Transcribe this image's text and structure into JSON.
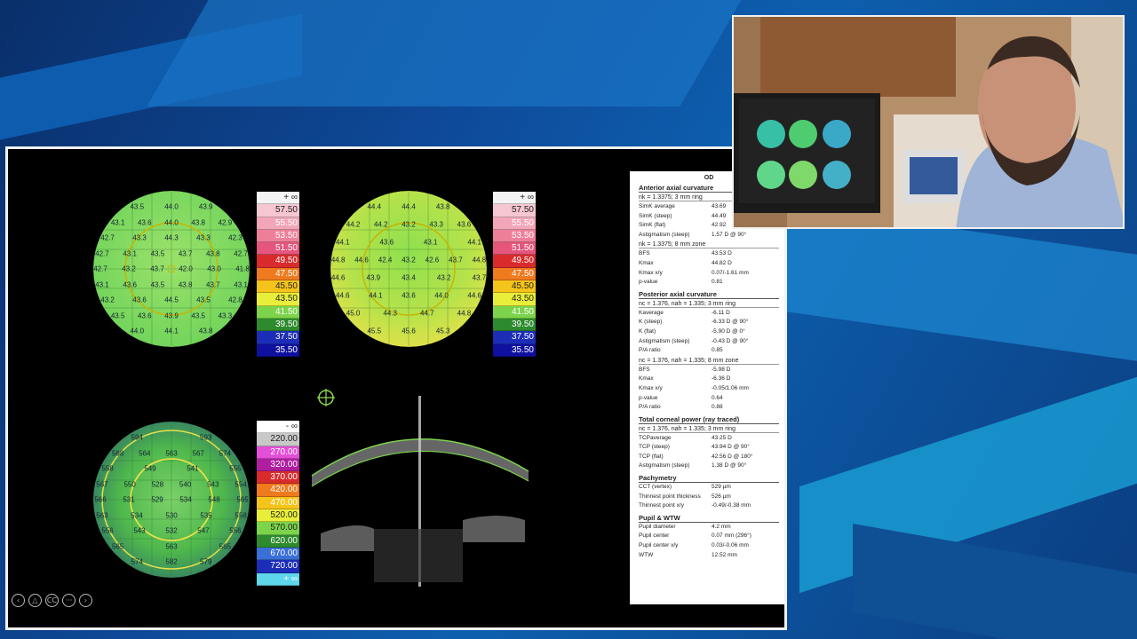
{
  "top_left_map": {
    "numbers": [
      [
        "43.5",
        "44.0",
        "43.9"
      ],
      [
        "43.1",
        "43.6",
        "44.0",
        "43.8",
        "42.9"
      ],
      [
        "42.7",
        "43.3",
        "44.3",
        "43.3",
        "42.3"
      ],
      [
        "42.7",
        "43.1",
        "43.5",
        "43.7",
        "43.8",
        "42.7"
      ],
      [
        "42.7",
        "43.2",
        "43.7",
        "42.0",
        "43.0",
        "41.8"
      ],
      [
        "43.1",
        "43.6",
        "43.5",
        "43.8",
        "43.7",
        "43.1"
      ],
      [
        "43.2",
        "43.6",
        "44.5",
        "43.5",
        "42.8"
      ],
      [
        "43.5",
        "43.6",
        "43.9",
        "43.5",
        "43.3"
      ],
      [
        "44.0",
        "44.1",
        "43.8"
      ]
    ],
    "scale": [
      "+ ∞",
      "57.50",
      "55.50",
      "53.50",
      "51.50",
      "49.50",
      "47.50",
      "45.50",
      "43.50",
      "41.50",
      "39.50",
      "37.50",
      "35.50"
    ]
  },
  "top_right_map": {
    "numbers": [
      [
        "44.4",
        "44.4",
        "43.8"
      ],
      [
        "44.2",
        "44.2",
        "43.2",
        "43.3",
        "43.6"
      ],
      [
        "44.1",
        "43.6",
        "43.1",
        "44.1"
      ],
      [
        "44.8",
        "44.6",
        "42.4",
        "43.2",
        "42.6",
        "43.7",
        "44.8"
      ],
      [
        "44.6",
        "43.9",
        "43.4",
        "43.2",
        "43.7"
      ],
      [
        "44.6",
        "44.1",
        "43.6",
        "44.0",
        "44.6"
      ],
      [
        "45.0",
        "44.3",
        "44.7",
        "44.8"
      ],
      [
        "45.5",
        "45.6",
        "45.3"
      ]
    ],
    "scale": [
      "+ ∞",
      "57.50",
      "55.50",
      "53.50",
      "51.50",
      "49.50",
      "47.50",
      "45.50",
      "43.50",
      "41.50",
      "39.50",
      "37.50",
      "35.50"
    ]
  },
  "bottom_left_map": {
    "numbers": [
      [
        "594",
        "593"
      ],
      [
        "568",
        "564",
        "563",
        "567",
        "574"
      ],
      [
        "558",
        "549",
        "541",
        "555"
      ],
      [
        "567",
        "550",
        "528",
        "540",
        "543",
        "554"
      ],
      [
        "566",
        "531",
        "529",
        "534",
        "548",
        "565"
      ],
      [
        "563",
        "534",
        "530",
        "535",
        "558"
      ],
      [
        "556",
        "543",
        "532",
        "547",
        "556"
      ],
      [
        "565",
        "563",
        "565"
      ],
      [
        "574",
        "582",
        "579"
      ]
    ],
    "scale": [
      "- ∞",
      "220.00",
      "270.00",
      "320.00",
      "370.00",
      "420.00",
      "470.00",
      "520.00",
      "570.00",
      "620.00",
      "670.00",
      "720.00",
      "+ ∞"
    ]
  },
  "report": {
    "od": "OD",
    "sections": [
      {
        "title": "Anterior axial curvature",
        "sub": "nk = 1.3375; 3 mm ring",
        "rows": [
          [
            "SimK average",
            "43.69"
          ],
          [
            "SimK (steep)",
            "44.49"
          ],
          [
            "SimK (flat)",
            "42.92"
          ],
          [
            "Astigmatism (steep)",
            "1.57 D @ 90°"
          ]
        ],
        "sub2": "nk = 1.3375; 8 mm zone",
        "rows2": [
          [
            "BFS",
            "43.53 D"
          ],
          [
            "Kmax",
            "44.82 D"
          ],
          [
            "Kmax x/y",
            "0.07/-1.61 mm"
          ],
          [
            "p-value",
            "0.81"
          ]
        ]
      },
      {
        "title": "Posterior axial curvature",
        "sub": "nc = 1.376, nah = 1.335; 3 mm ring",
        "rows": [
          [
            "Kaverage",
            "-6.11 D"
          ],
          [
            "K (steep)",
            "-6.33 D @ 90°"
          ],
          [
            "K (flat)",
            "-5.90 D @ 0°"
          ],
          [
            "Astigmatism (steep)",
            "-0.43 D @ 90°"
          ],
          [
            "P/A ratio",
            "0.85"
          ]
        ],
        "sub2": "nc = 1.376, nah = 1.335; 8 mm zone",
        "rows2": [
          [
            "BFS",
            "-5.98 D"
          ],
          [
            "Kmax",
            "-6.36 D"
          ],
          [
            "Kmax x/y",
            "-0.05/1.06 mm"
          ],
          [
            "p-value",
            "0.64"
          ],
          [
            "P/A ratio",
            "0.88"
          ]
        ]
      },
      {
        "title": "Total corneal power (ray traced)",
        "sub": "nc = 1.376, nah = 1.335; 3 mm ring",
        "rows": [
          [
            "TCPaverage",
            "43.25 D"
          ],
          [
            "TCP (steep)",
            "43.94 D @ 90°"
          ],
          [
            "TCP (flat)",
            "42.56 D @ 180°"
          ],
          [
            "Astigmatism (steep)",
            "1.38 D @ 90°"
          ]
        ],
        "sub2": "",
        "rows2": []
      },
      {
        "title": "Pachymetry",
        "sub": "",
        "rows": [
          [
            "CCT (vertex)",
            "529 µm"
          ],
          [
            "Thinnest point thickness",
            "526 µm"
          ],
          [
            "Thinnest point x/y",
            "-0.49/-0.38 mm"
          ]
        ],
        "sub2": "",
        "rows2": []
      },
      {
        "title": "Pupil & WTW",
        "sub": "",
        "rows": [
          [
            "Pupil diameter",
            "4.2 mm"
          ],
          [
            "Pupil center",
            "0.07 mm (296°)"
          ],
          [
            "Pupil center x/y",
            "0.03/-0.06 mm"
          ],
          [
            "WTW",
            "12.52 mm"
          ]
        ],
        "sub2": "",
        "rows2": []
      }
    ]
  },
  "controls": [
    "prev-icon",
    "home-icon",
    "cc-icon",
    "more-icon",
    "next-icon"
  ],
  "colors": {
    "slide_bg": "#000000",
    "report_bg": "#ffffff",
    "bg_blue": "#0d5fae",
    "scan_green": "#7bd44a"
  }
}
